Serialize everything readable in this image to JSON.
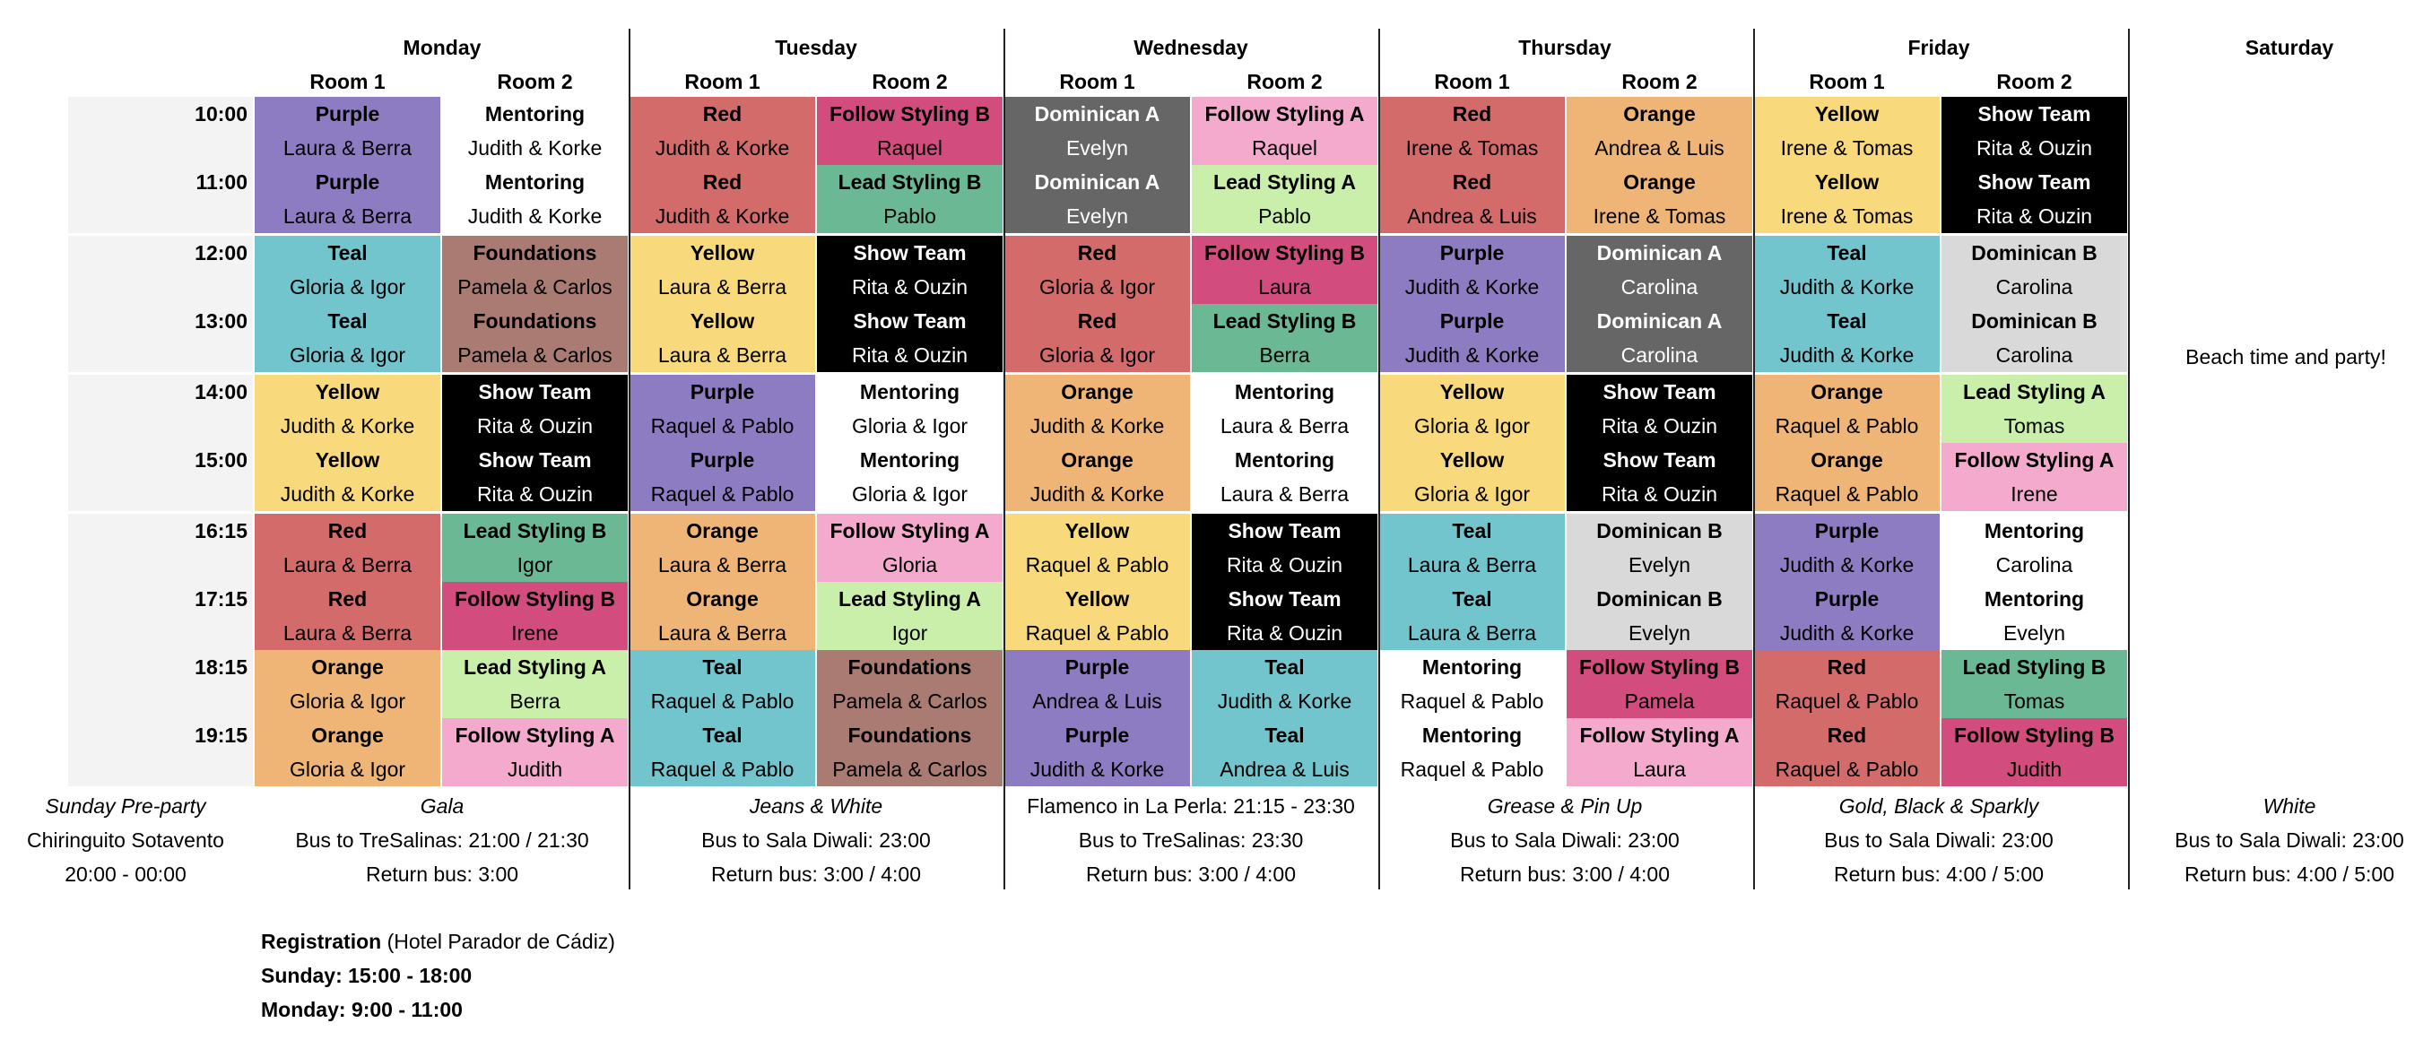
{
  "colors": {
    "Purple": "#8e7cc3",
    "Red": "#d36b6b",
    "Teal": "#72c4cd",
    "Yellow": "#f8da7c",
    "Orange": "#efb576",
    "Show Team": "#000000",
    "Mentoring": "#ffffff",
    "Foundations": "#a97b72",
    "Dominican A": "#666666",
    "Dominican B": "#d9d9d9",
    "Follow Styling A": "#f3aacd",
    "Follow Styling B": "#d24d7d",
    "Lead Styling A": "#c9efaa",
    "Lead Styling B": "#6ab894"
  },
  "light_text_classes": [
    "Show Team",
    "Dominican A"
  ],
  "days": [
    "Monday",
    "Tuesday",
    "Wednesday",
    "Thursday",
    "Friday",
    "Saturday"
  ],
  "room_labels": [
    "Room 1",
    "Room 2"
  ],
  "times": [
    "10:00",
    "11:00",
    "12:00",
    "13:00",
    "14:00",
    "15:00",
    "16:15",
    "17:15",
    "18:15",
    "19:15"
  ],
  "schedule": [
    [
      [
        [
          "Purple",
          "Laura & Berra"
        ],
        [
          "Mentoring",
          "Judith & Korke"
        ]
      ],
      [
        [
          "Red",
          "Judith & Korke"
        ],
        [
          "Follow Styling B",
          "Raquel"
        ]
      ],
      [
        [
          "Dominican A",
          "Evelyn"
        ],
        [
          "Follow Styling A",
          "Raquel"
        ]
      ],
      [
        [
          "Red",
          "Irene & Tomas"
        ],
        [
          "Orange",
          "Andrea & Luis"
        ]
      ],
      [
        [
          "Yellow",
          "Irene & Tomas"
        ],
        [
          "Show Team",
          "Rita & Ouzin"
        ]
      ]
    ],
    [
      [
        [
          "Purple",
          "Laura & Berra"
        ],
        [
          "Mentoring",
          "Judith & Korke"
        ]
      ],
      [
        [
          "Red",
          "Judith & Korke"
        ],
        [
          "Lead Styling B",
          "Pablo"
        ]
      ],
      [
        [
          "Dominican A",
          "Evelyn"
        ],
        [
          "Lead Styling A",
          "Pablo"
        ]
      ],
      [
        [
          "Red",
          "Andrea & Luis"
        ],
        [
          "Orange",
          "Irene & Tomas"
        ]
      ],
      [
        [
          "Yellow",
          "Irene & Tomas"
        ],
        [
          "Show Team",
          "Rita & Ouzin"
        ]
      ]
    ],
    [
      [
        [
          "Teal",
          "Gloria & Igor"
        ],
        [
          "Foundations",
          "Pamela & Carlos"
        ]
      ],
      [
        [
          "Yellow",
          "Laura & Berra"
        ],
        [
          "Show Team",
          "Rita & Ouzin"
        ]
      ],
      [
        [
          "Red",
          "Gloria & Igor"
        ],
        [
          "Follow Styling B",
          "Laura"
        ]
      ],
      [
        [
          "Purple",
          "Judith & Korke"
        ],
        [
          "Dominican A",
          "Carolina"
        ]
      ],
      [
        [
          "Teal",
          "Judith & Korke"
        ],
        [
          "Dominican B",
          "Carolina"
        ]
      ]
    ],
    [
      [
        [
          "Teal",
          "Gloria & Igor"
        ],
        [
          "Foundations",
          "Pamela & Carlos"
        ]
      ],
      [
        [
          "Yellow",
          "Laura & Berra"
        ],
        [
          "Show Team",
          "Rita & Ouzin"
        ]
      ],
      [
        [
          "Red",
          "Gloria & Igor"
        ],
        [
          "Lead Styling B",
          "Berra"
        ]
      ],
      [
        [
          "Purple",
          "Judith & Korke"
        ],
        [
          "Dominican A",
          "Carolina"
        ]
      ],
      [
        [
          "Teal",
          "Judith & Korke"
        ],
        [
          "Dominican B",
          "Carolina"
        ]
      ]
    ],
    [
      [
        [
          "Yellow",
          "Judith & Korke"
        ],
        [
          "Show Team",
          "Rita & Ouzin"
        ]
      ],
      [
        [
          "Purple",
          "Raquel & Pablo"
        ],
        [
          "Mentoring",
          "Gloria & Igor"
        ]
      ],
      [
        [
          "Orange",
          "Judith & Korke"
        ],
        [
          "Mentoring",
          "Laura & Berra"
        ]
      ],
      [
        [
          "Yellow",
          "Gloria & Igor"
        ],
        [
          "Show Team",
          "Rita & Ouzin"
        ]
      ],
      [
        [
          "Orange",
          "Raquel & Pablo"
        ],
        [
          "Lead Styling A",
          "Tomas"
        ]
      ]
    ],
    [
      [
        [
          "Yellow",
          "Judith & Korke"
        ],
        [
          "Show Team",
          "Rita & Ouzin"
        ]
      ],
      [
        [
          "Purple",
          "Raquel & Pablo"
        ],
        [
          "Mentoring",
          "Gloria & Igor"
        ]
      ],
      [
        [
          "Orange",
          "Judith & Korke"
        ],
        [
          "Mentoring",
          "Laura & Berra"
        ]
      ],
      [
        [
          "Yellow",
          "Gloria & Igor"
        ],
        [
          "Show Team",
          "Rita & Ouzin"
        ]
      ],
      [
        [
          "Orange",
          "Raquel & Pablo"
        ],
        [
          "Follow Styling A",
          "Irene"
        ]
      ]
    ],
    [
      [
        [
          "Red",
          "Laura & Berra"
        ],
        [
          "Lead Styling B",
          "Igor"
        ]
      ],
      [
        [
          "Orange",
          "Laura & Berra"
        ],
        [
          "Follow Styling A",
          "Gloria"
        ]
      ],
      [
        [
          "Yellow",
          "Raquel & Pablo"
        ],
        [
          "Show Team",
          "Rita & Ouzin"
        ]
      ],
      [
        [
          "Teal",
          "Laura & Berra"
        ],
        [
          "Dominican B",
          "Evelyn"
        ]
      ],
      [
        [
          "Purple",
          "Judith & Korke"
        ],
        [
          "Mentoring",
          "Carolina"
        ]
      ]
    ],
    [
      [
        [
          "Red",
          "Laura & Berra"
        ],
        [
          "Follow Styling B",
          "Irene"
        ]
      ],
      [
        [
          "Orange",
          "Laura & Berra"
        ],
        [
          "Lead Styling A",
          "Igor"
        ]
      ],
      [
        [
          "Yellow",
          "Raquel & Pablo"
        ],
        [
          "Show Team",
          "Rita & Ouzin"
        ]
      ],
      [
        [
          "Teal",
          "Laura & Berra"
        ],
        [
          "Dominican B",
          "Evelyn"
        ]
      ],
      [
        [
          "Purple",
          "Judith & Korke"
        ],
        [
          "Mentoring",
          "Evelyn"
        ]
      ]
    ],
    [
      [
        [
          "Orange",
          "Gloria & Igor"
        ],
        [
          "Lead Styling A",
          "Berra"
        ]
      ],
      [
        [
          "Teal",
          "Raquel & Pablo"
        ],
        [
          "Foundations",
          "Pamela & Carlos"
        ]
      ],
      [
        [
          "Purple",
          "Andrea & Luis"
        ],
        [
          "Teal",
          "Judith & Korke"
        ]
      ],
      [
        [
          "Mentoring",
          "Raquel & Pablo"
        ],
        [
          "Follow Styling B",
          "Pamela"
        ]
      ],
      [
        [
          "Red",
          "Raquel & Pablo"
        ],
        [
          "Lead Styling B",
          "Tomas"
        ]
      ]
    ],
    [
      [
        [
          "Orange",
          "Gloria & Igor"
        ],
        [
          "Follow Styling A",
          "Judith"
        ]
      ],
      [
        [
          "Teal",
          "Raquel & Pablo"
        ],
        [
          "Foundations",
          "Pamela & Carlos"
        ]
      ],
      [
        [
          "Purple",
          "Judith & Korke"
        ],
        [
          "Teal",
          "Andrea & Luis"
        ]
      ],
      [
        [
          "Mentoring",
          "Raquel & Pablo"
        ],
        [
          "Follow Styling A",
          "Laura"
        ]
      ],
      [
        [
          "Red",
          "Raquel & Pablo"
        ],
        [
          "Follow Styling B",
          "Judith"
        ]
      ]
    ]
  ],
  "saturday_note": "Beach time and party!",
  "sunday": [
    "Sunday Pre-party",
    "Chiringuito Sotavento",
    "20:00 - 00:00"
  ],
  "parties": [
    {
      "theme": "Gala",
      "italic": true,
      "bus": "Bus to TreSalinas: 21:00 / 21:30",
      "ret": "Return bus: 3:00"
    },
    {
      "theme": "Jeans & White",
      "italic": true,
      "bus": "Bus to Sala Diwali: 23:00",
      "ret": "Return bus: 3:00 / 4:00"
    },
    {
      "theme": "Flamenco in La Perla: 21:15 - 23:30",
      "italic": false,
      "bus": "Bus to TreSalinas: 23:30",
      "ret": "Return bus: 3:00 / 4:00"
    },
    {
      "theme": "Grease & Pin Up",
      "italic": true,
      "bus": "Bus to Sala Diwali: 23:00",
      "ret": "Return bus: 3:00 / 4:00"
    },
    {
      "theme": "Gold, Black & Sparkly",
      "italic": true,
      "bus": "Bus to Sala Diwali: 23:00",
      "ret": "Return bus: 4:00 / 5:00"
    },
    {
      "theme": "White",
      "italic": true,
      "bus": "Bus to Sala Diwali: 23:00",
      "ret": "Return bus: 4:00 / 5:00"
    }
  ],
  "registration": {
    "label": "Registration",
    "place": " (Hotel Parador de Cádiz)",
    "sunday": "Sunday: 15:00 - 18:00",
    "monday": "Monday: 9:00 - 11:00"
  }
}
